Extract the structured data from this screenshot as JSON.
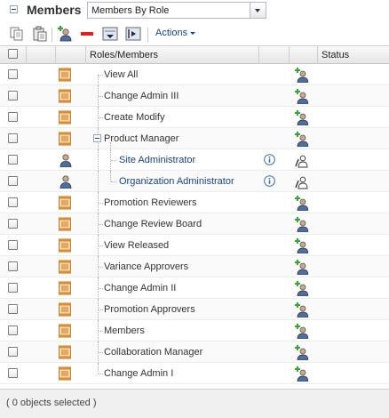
{
  "panel": {
    "title": "Members",
    "view_selected": "Members By Role"
  },
  "toolbar": {
    "actions_label": "Actions"
  },
  "columns": [
    "Roles/Members",
    "Status"
  ],
  "rows": [
    {
      "kind": "role",
      "label": "View All"
    },
    {
      "kind": "role",
      "label": "Change Admin III"
    },
    {
      "kind": "role",
      "label": "Create Modify"
    },
    {
      "kind": "role-expanded",
      "label": "Product Manager"
    },
    {
      "kind": "member",
      "label": "Site Administrator"
    },
    {
      "kind": "member",
      "label": "Organization Administrator"
    },
    {
      "kind": "role",
      "label": "Promotion Reviewers"
    },
    {
      "kind": "role",
      "label": "Change Review Board"
    },
    {
      "kind": "role",
      "label": "View Released"
    },
    {
      "kind": "role",
      "label": "Variance Approvers"
    },
    {
      "kind": "role",
      "label": "Change Admin II"
    },
    {
      "kind": "role",
      "label": "Promotion Approvers"
    },
    {
      "kind": "role",
      "label": "Members"
    },
    {
      "kind": "role",
      "label": "Collaboration Manager"
    },
    {
      "kind": "role",
      "label": "Change Admin I"
    }
  ],
  "footer": {
    "selection_status": "( 0 objects selected )"
  },
  "icons": {
    "role": "role-document-icon",
    "member": "user-icon",
    "add": "add-member-icon",
    "remove": "remove-member-icon",
    "info": "info-icon"
  },
  "colors": {
    "link": "#15428b",
    "add_green": "#3aa534",
    "remove_red": "#e02020"
  }
}
